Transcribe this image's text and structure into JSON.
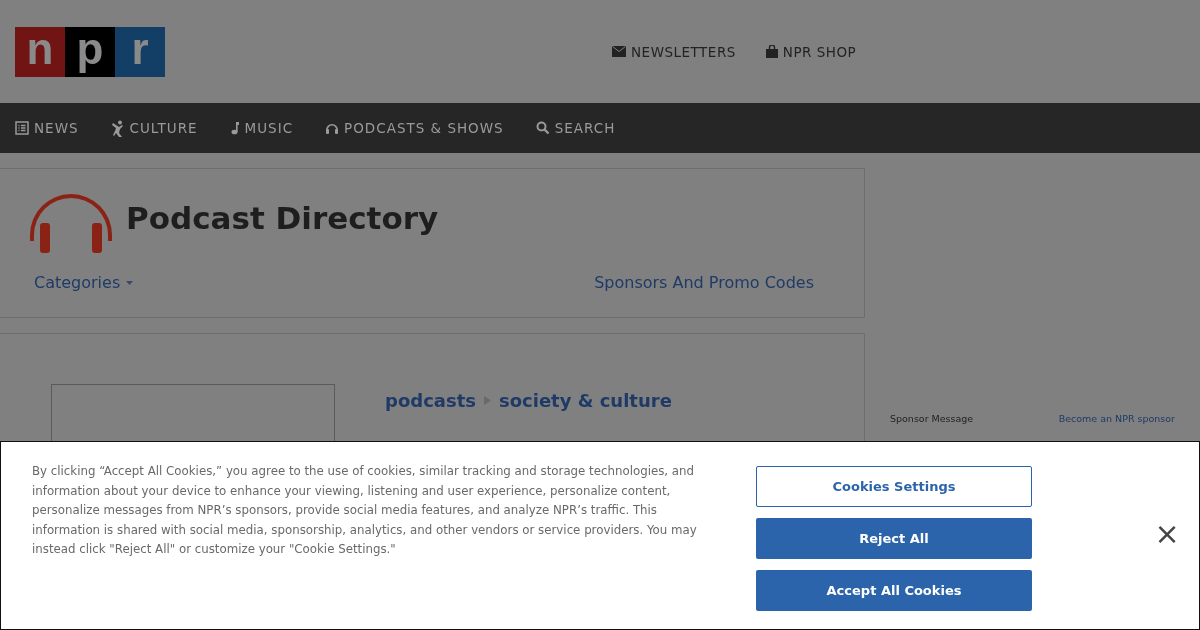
{
  "logo": {
    "letters": [
      "n",
      "p",
      "r"
    ]
  },
  "header_links": [
    {
      "kind": "mail",
      "label": "NEWSLETTERS"
    },
    {
      "kind": "bag",
      "label": "NPR SHOP"
    }
  ],
  "nav": [
    {
      "kind": "news",
      "label": "NEWS"
    },
    {
      "kind": "culture",
      "label": "CULTURE"
    },
    {
      "kind": "music",
      "label": "MUSIC"
    },
    {
      "kind": "podcasts",
      "label": "PODCASTS & SHOWS"
    },
    {
      "kind": "search",
      "label": "SEARCH"
    }
  ],
  "directory": {
    "title": "Podcast Directory",
    "categories": "Categories",
    "sponsors_link": "Sponsors And Promo Codes"
  },
  "breadcrumb": [
    "podcasts",
    "society & culture"
  ],
  "sidebar": {
    "sponsor_message": "Sponsor Message",
    "sponsor_link": "Become an NPR sponsor"
  },
  "cookie_banner": {
    "text": "By clicking “Accept All Cookies,” you agree to the use of cookies, similar tracking and storage technologies, and information about your device to enhance your viewing, listening and user experience, personalize content, personalize messages from NPR’s sponsors, provide social media features, and analyze NPR’s traffic. This information is shared with social media, sponsorship, analytics, and other vendors or service providers. You may instead click \"Reject All\" or customize your \"Cookie Settings.\"",
    "buttons": [
      {
        "kind": "outline",
        "label": "Cookies Settings"
      },
      {
        "kind": "filled",
        "label": "Reject All"
      },
      {
        "kind": "filled",
        "label": "Accept All Cookies"
      }
    ],
    "close": "×"
  }
}
